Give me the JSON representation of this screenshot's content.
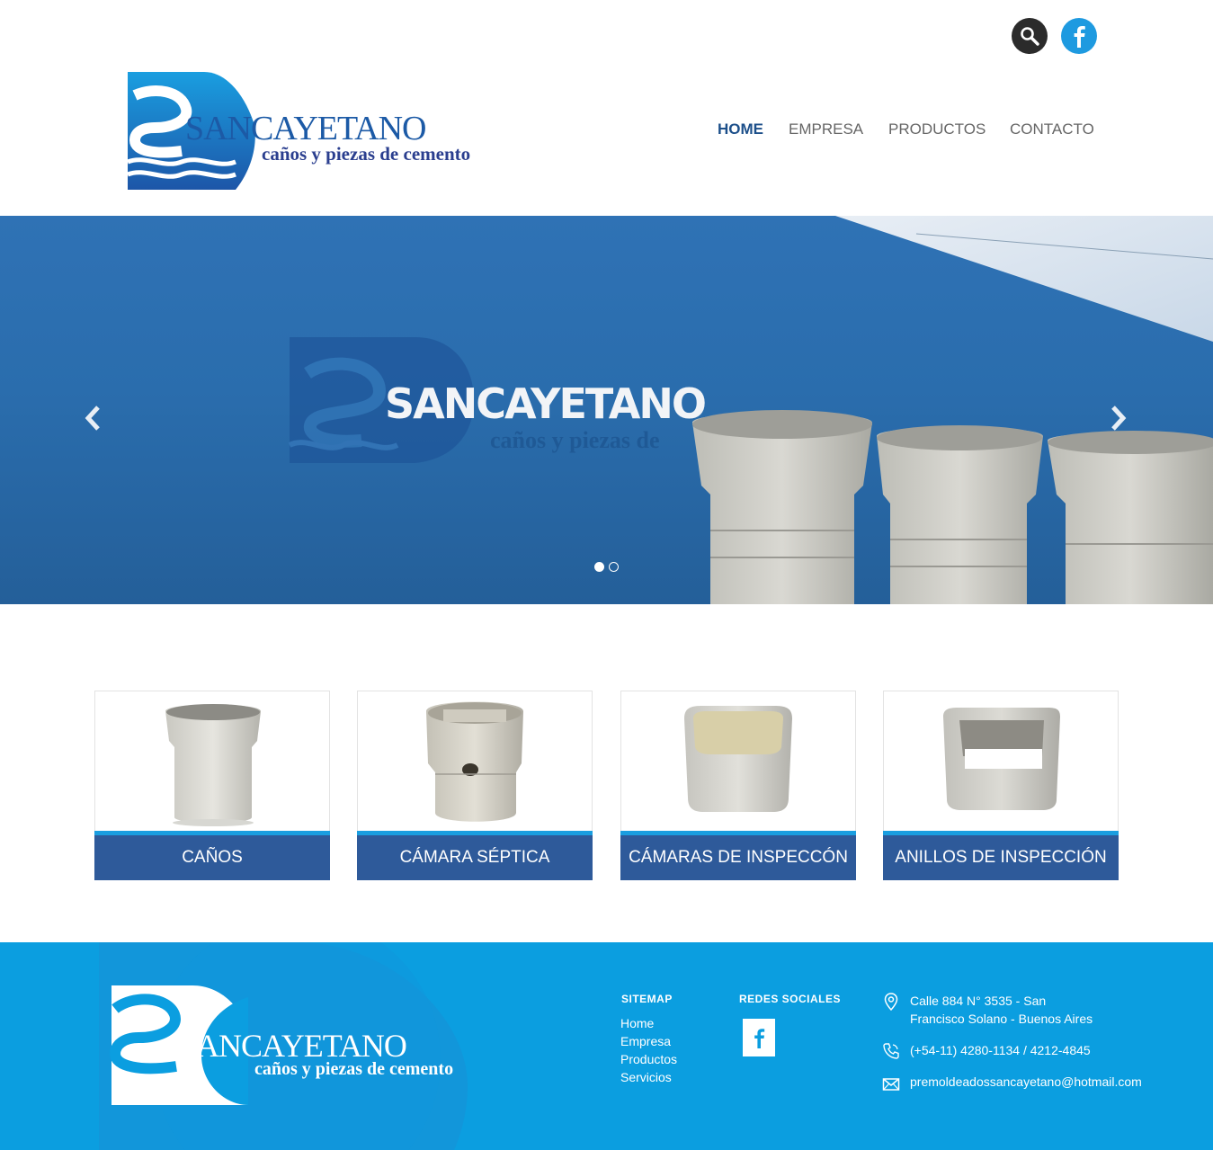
{
  "header": {
    "brand_name": "SANCAYETANO",
    "brand_tagline": "caños y piezas de cemento",
    "search_icon": "search-icon",
    "facebook_icon": "facebook-icon",
    "nav": [
      {
        "label": "HOME",
        "active": true
      },
      {
        "label": "EMPRESA",
        "active": false
      },
      {
        "label": "PRODUCTOS",
        "active": false
      },
      {
        "label": "CONTACTO",
        "active": false
      }
    ]
  },
  "slider": {
    "sign_name": "SANCAYETANO",
    "sign_tagline": "caños y piezas de",
    "prev_icon": "chevron-left-icon",
    "next_icon": "chevron-right-icon",
    "slide_count": 2,
    "active_slide": 1
  },
  "products": [
    {
      "label": "CAÑOS"
    },
    {
      "label": "CÁMARA SÉPTICA"
    },
    {
      "label": "CÁMARAS DE INSPECCÓN"
    },
    {
      "label": "ANILLOS DE INSPECCIÓN"
    }
  ],
  "footer": {
    "brand_name": "SANCAYETANO",
    "brand_tagline": "caños y piezas de cemento",
    "sitemap_title": "SITEMAP",
    "sitemap_links": [
      "Home",
      "Empresa",
      "Productos",
      "Servicios"
    ],
    "social_title": "REDES SOCIALES",
    "address_line1": "Calle 884 N° 3535 - San",
    "address_line2": "Francisco Solano - Buenos Aires",
    "phone": "(+54-11) 4280-1134 / 4212-4845",
    "email": "premoldeadossancayetano@hotmail.com"
  },
  "colors": {
    "brand_blue": "#1e9ae0",
    "nav_active": "#1c4f8a",
    "card_label_bg": "#2e5a9a",
    "footer_bg": "#0b9ee0"
  }
}
